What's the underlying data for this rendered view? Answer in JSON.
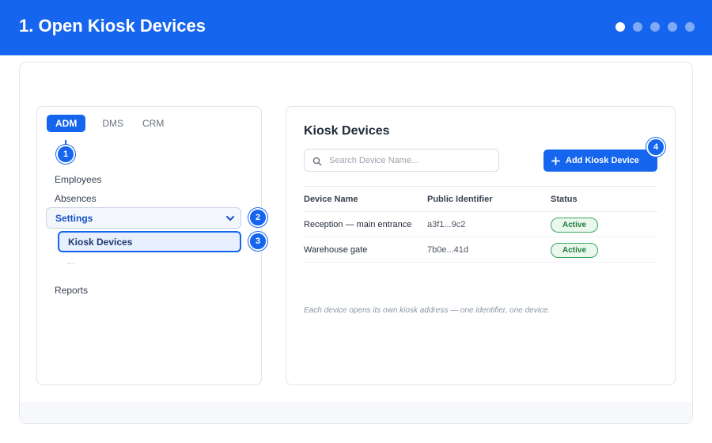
{
  "header": {
    "title": "1. Open Kiosk Devices",
    "steps": [
      true,
      false,
      false,
      false,
      false
    ]
  },
  "sidebar": {
    "tabs": [
      {
        "label": "ADM",
        "active": true
      },
      {
        "label": "DMS",
        "active": false
      },
      {
        "label": "CRM",
        "active": false
      }
    ],
    "items": {
      "employees": "Employees",
      "absences": "Absences",
      "settings": "Settings",
      "kiosk_devices": "Kiosk Devices",
      "more": "...",
      "reports": "Reports"
    }
  },
  "markers": [
    "1",
    "2",
    "3",
    "4"
  ],
  "main": {
    "title": "Kiosk Devices",
    "search_placeholder": "Search Device Name...",
    "add_button": "Add Kiosk Device",
    "columns": [
      "Device Name",
      "Public Identifier",
      "Status"
    ],
    "rows": [
      {
        "name": "Reception — main entrance",
        "identifier": "a3f1...9c2",
        "status": "Active"
      },
      {
        "name": "Warehouse gate",
        "identifier": "7b0e...41d",
        "status": "Active"
      }
    ],
    "note": "Each device opens its own kiosk address — one identifier, one device."
  },
  "colors": {
    "accent": "#1565ee",
    "status_active": "#1d7a3c"
  }
}
